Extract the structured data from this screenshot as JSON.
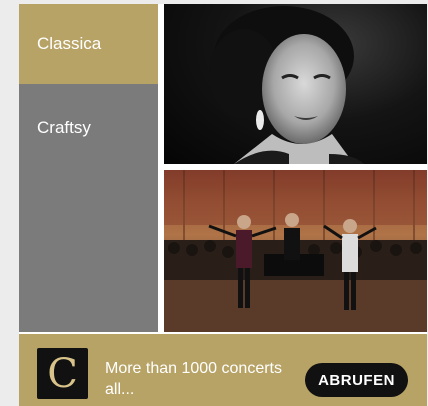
{
  "ad": {
    "categories": [
      {
        "label": "Classica",
        "color": "#b8a366"
      },
      {
        "label": "Craftsy",
        "color": "#7b7b7b"
      }
    ],
    "images": [
      {
        "name": "singer-portrait-bw"
      },
      {
        "name": "orchestra-concert-stage"
      }
    ],
    "logo_letter": "C",
    "text": "More than 1000 concerts all...",
    "cta_label": "ABRUFEN",
    "colors": {
      "accent": "#b8a366",
      "secondary": "#7b7b7b",
      "button": "#111111",
      "text": "#ffffff"
    }
  }
}
